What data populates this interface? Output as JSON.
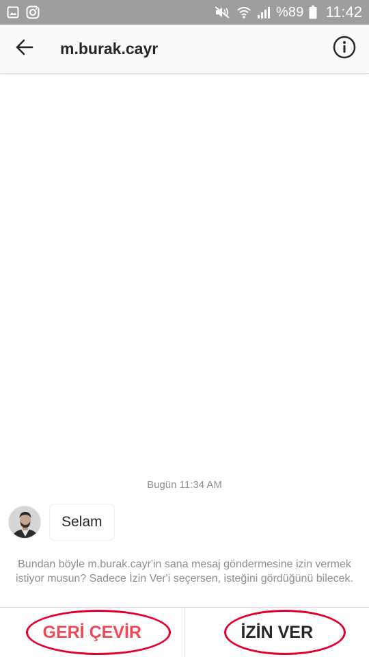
{
  "status_bar": {
    "left_icons": [
      "gallery-icon",
      "instagram-icon"
    ],
    "right_icons": [
      "mute-icon",
      "wifi-icon",
      "signal-icon",
      "battery-icon"
    ],
    "battery": "%89",
    "time": "11:42",
    "background": "#9e9e9e"
  },
  "header": {
    "back_icon": "arrow-left-icon",
    "title": "m.burak.cayr",
    "info_icon": "info-icon"
  },
  "conversation": {
    "timestamp": "Bugün 11:34 AM",
    "messages": [
      {
        "sender": "m.burak.cayr",
        "avatar": "avatar-photo",
        "text": "Selam"
      }
    ]
  },
  "request_notice": "Bundan böyle m.burak.cayr'in sana mesaj göndermesine izin vermek istiyor musun? Sadece İzin Ver'i seçersen, isteğini gördüğünü bilecek.",
  "actions": {
    "decline_label": "GERİ ÇEVİR",
    "accept_label": "İZİN VER"
  },
  "colors": {
    "decline": "#ed4956",
    "annotation_ring": "#e4002b",
    "text": "#262626",
    "muted_text": "#8e8e8e"
  }
}
